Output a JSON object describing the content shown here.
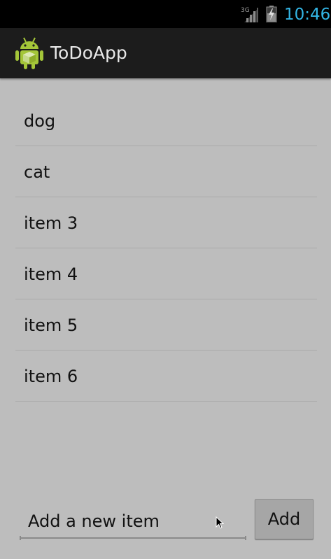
{
  "status_bar": {
    "network": "3G",
    "time": "10:46",
    "clock_color": "#33b5e5",
    "icons": [
      "signal-3g-icon",
      "battery-charging-icon"
    ]
  },
  "action_bar": {
    "title": "ToDoApp",
    "icon": "android-robot-icon"
  },
  "todo_list": {
    "items": [
      {
        "label": "dog"
      },
      {
        "label": "cat"
      },
      {
        "label": "item 3"
      },
      {
        "label": "item 4"
      },
      {
        "label": "item 5"
      },
      {
        "label": "item 6"
      }
    ]
  },
  "new_item": {
    "placeholder": "Add a new item",
    "value": "",
    "add_label": "Add"
  }
}
